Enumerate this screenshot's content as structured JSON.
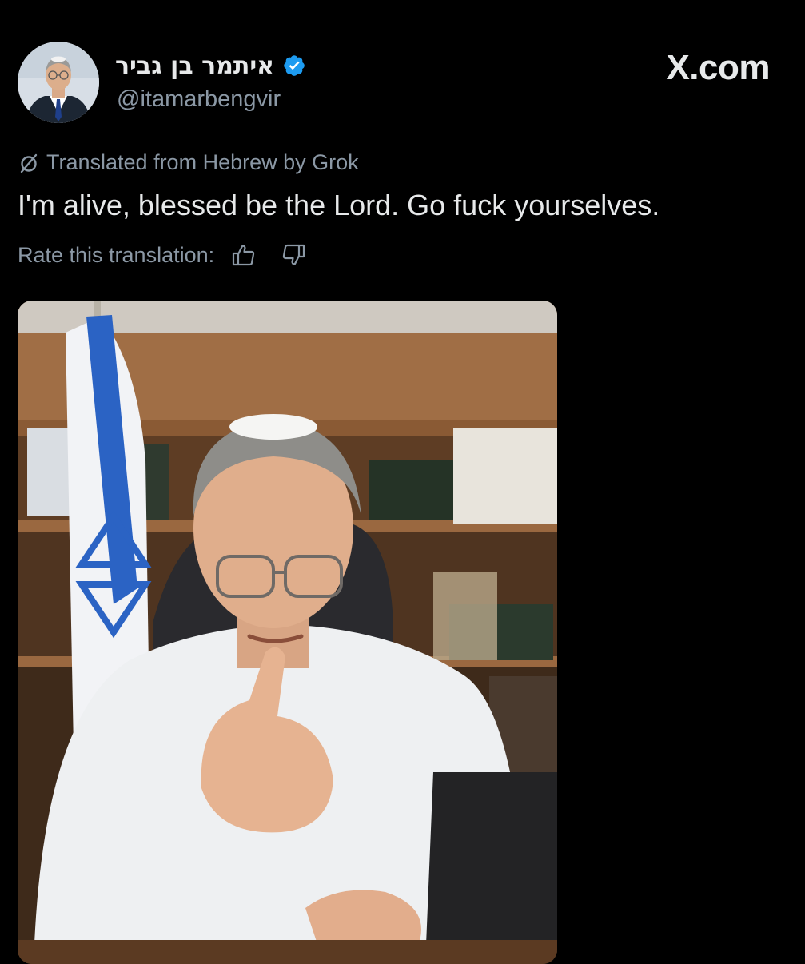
{
  "tweet": {
    "display_name": "איתמר בן גביר",
    "handle": "@itamarbengvir",
    "verified": true,
    "text": "I'm alive, blessed be the Lord. Go fuck yourselves.",
    "translation_note": "Translated from Hebrew by Grok",
    "rate_label": "Rate this translation:"
  },
  "site": {
    "logo": "X.com"
  },
  "icons": {
    "verified": "verified-badge-icon",
    "translate": "translate-icon",
    "thumbs_up": "thumbs-up-icon",
    "thumbs_down": "thumbs-down-icon"
  },
  "colors": {
    "background": "#000000",
    "text_primary": "#e7e9ea",
    "text_secondary": "#8b98a5",
    "verified_blue": "#1d9bf0"
  }
}
